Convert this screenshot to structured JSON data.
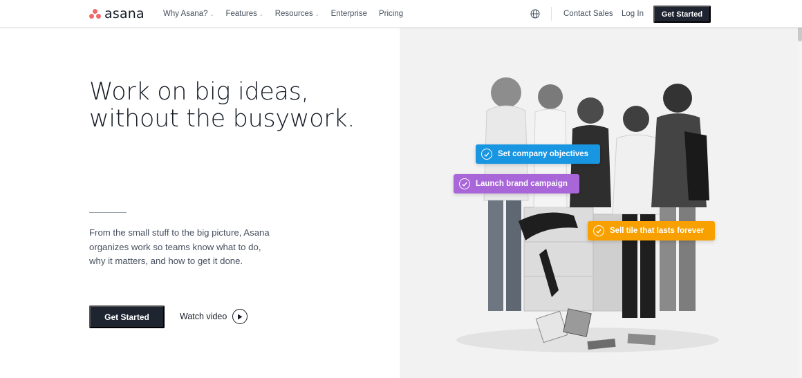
{
  "header": {
    "logo_text": "asana",
    "nav": [
      {
        "label": "Why Asana?",
        "has_dropdown": true
      },
      {
        "label": "Features",
        "has_dropdown": true
      },
      {
        "label": "Resources",
        "has_dropdown": true
      },
      {
        "label": "Enterprise",
        "has_dropdown": false
      },
      {
        "label": "Pricing",
        "has_dropdown": false
      }
    ],
    "language_icon": "globe-icon",
    "contact_sales": "Contact Sales",
    "login": "Log In",
    "get_started": "Get Started"
  },
  "hero": {
    "headline_line1": "Work on big ideas,",
    "headline_line2": "without the busywork.",
    "subcopy_line1": "From the small stuff to the big picture, Asana",
    "subcopy_line2": "organizes work so teams know what to do,",
    "subcopy_line3": "why it matters, and how to get it done.",
    "cta_label": "Get Started",
    "watch_video_label": "Watch video"
  },
  "tasks": [
    {
      "label": "Set company objectives",
      "color": "#1996e2"
    },
    {
      "label": "Launch brand campaign",
      "color": "#a866d9"
    },
    {
      "label": "Sell tile that lasts forever",
      "color": "#f7a000"
    }
  ],
  "colors": {
    "brand_coral": "#f06a6a",
    "button_dark": "#1e2430",
    "text_dark": "#151b26",
    "text_muted": "#46505e",
    "panel_gray": "#f2f2f2"
  }
}
